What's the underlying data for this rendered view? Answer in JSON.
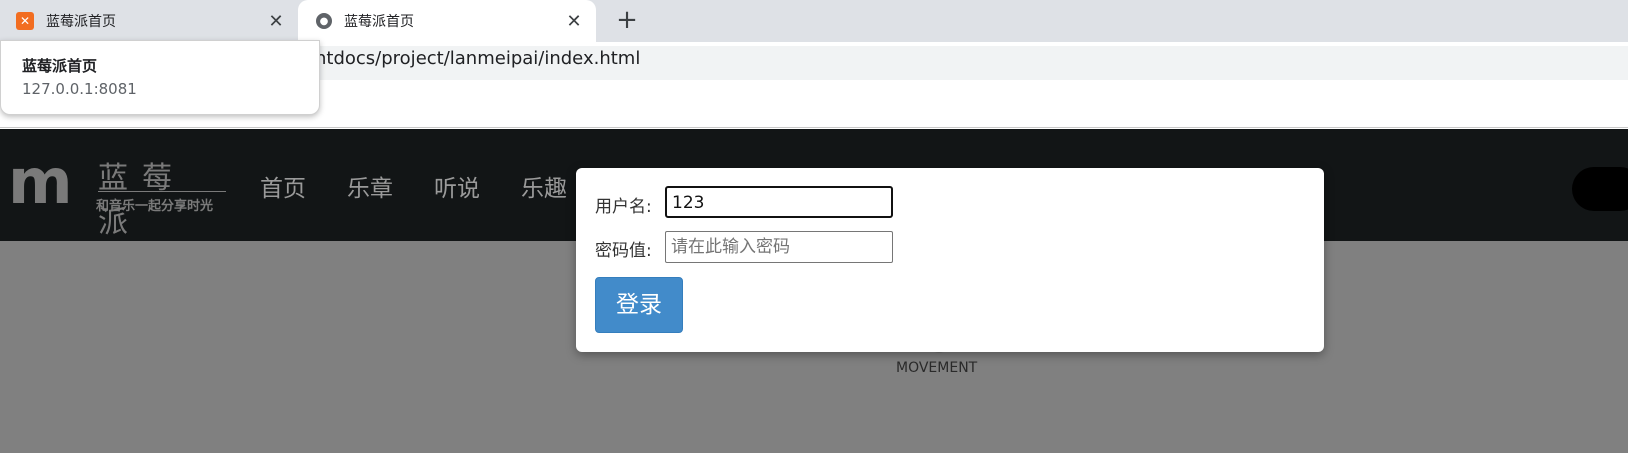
{
  "tabs": [
    {
      "title": "蓝莓派首页",
      "favicon": "xampp-icon",
      "close": "✕"
    },
    {
      "title": "蓝莓派首页",
      "favicon": "globe-icon",
      "close": "✕"
    }
  ],
  "new_tab": "+",
  "address_bar": {
    "url_visible": "htdocs/project/lanmeipai/index.html"
  },
  "tooltip": {
    "title": "蓝莓派首页",
    "url": "127.0.0.1:8081"
  },
  "site": {
    "logo": {
      "chinese": "蓝莓派",
      "slogan": "和音乐一起分享时光"
    },
    "nav": [
      "首页",
      "乐章",
      "听说",
      "乐趣"
    ],
    "section_label": "MOVEMENT"
  },
  "login_modal": {
    "username_label": "用户名:",
    "username_value": "123",
    "password_label": "密码值:",
    "password_placeholder": "请在此输入密码",
    "submit_label": "登录",
    "accent_color": "#428bca"
  }
}
